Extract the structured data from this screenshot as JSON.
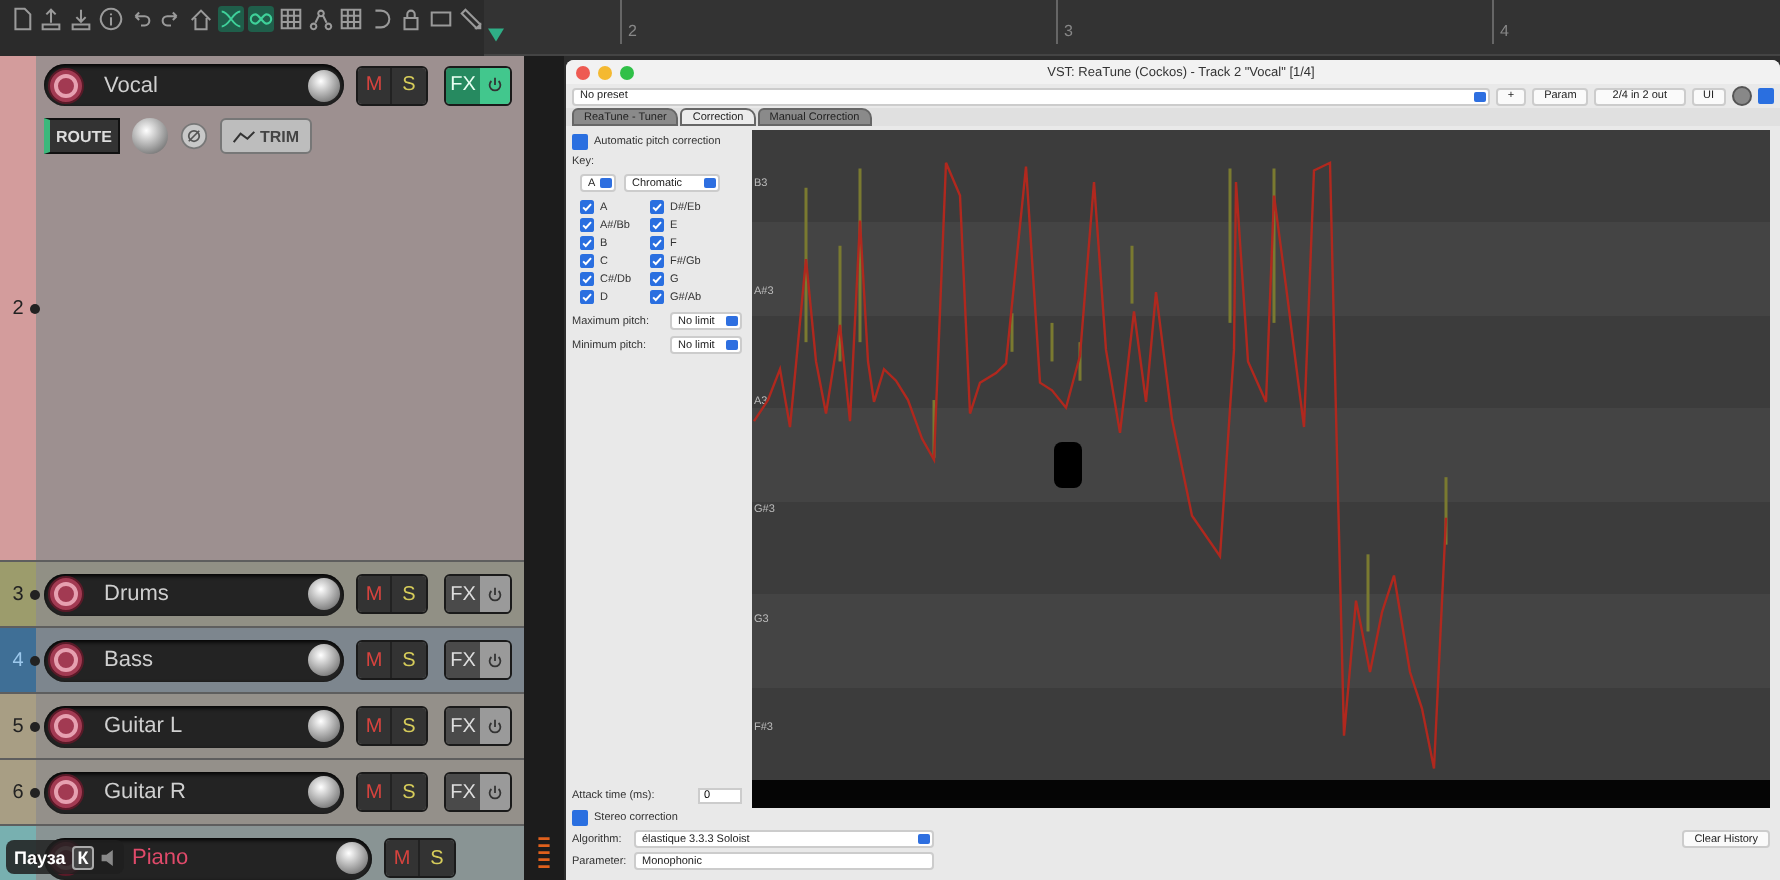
{
  "toolbar": [
    {
      "kind": "document",
      "on": false
    },
    {
      "kind": "upload",
      "on": false
    },
    {
      "kind": "download",
      "on": false
    },
    {
      "kind": "info",
      "on": false
    },
    {
      "kind": "undo",
      "on": false
    },
    {
      "kind": "redo",
      "on": false
    },
    {
      "kind": "house",
      "on": false
    },
    {
      "kind": "crossfade",
      "on": true
    },
    {
      "kind": "loop",
      "on": true
    },
    {
      "kind": "grid",
      "on": false
    },
    {
      "kind": "nodes",
      "on": false
    },
    {
      "kind": "grid",
      "on": false
    },
    {
      "kind": "curve",
      "on": false
    },
    {
      "kind": "lock",
      "on": false
    },
    {
      "kind": "rect",
      "on": false
    },
    {
      "kind": "pencil",
      "on": false
    }
  ],
  "ruler": {
    "marks": [
      "2",
      "3",
      "4"
    ]
  },
  "tracks": [
    {
      "kind": "expanded",
      "number": "2",
      "name": "Vocal",
      "color": "#d39c9c",
      "armed": false,
      "mute": "M",
      "solo": "S",
      "fx": "FX",
      "fx_on": true,
      "route": "ROUTE",
      "trim": "TRIM"
    },
    {
      "kind": "compact",
      "number": "3",
      "name": "Drums",
      "color": "#9c9c6c",
      "armed": false,
      "mute": "M",
      "solo": "S",
      "fx": "FX",
      "fx_on": false
    },
    {
      "kind": "compact",
      "number": "4",
      "name": "Bass",
      "color": "#3f6f96",
      "armed": false,
      "mute": "M",
      "solo": "S",
      "fx": "FX",
      "fx_on": false
    },
    {
      "kind": "compact",
      "number": "5",
      "name": "Guitar L",
      "color": "#a89e84",
      "armed": false,
      "mute": "M",
      "solo": "S",
      "fx": "FX",
      "fx_on": false
    },
    {
      "kind": "compact",
      "number": "6",
      "name": "Guitar R",
      "color": "#a89e84",
      "armed": false,
      "mute": "M",
      "solo": "S",
      "fx": "FX",
      "fx_on": false
    },
    {
      "kind": "compact",
      "name": "Piano",
      "color": "#78b0b0",
      "armed": true,
      "mute": "M",
      "solo": "S"
    }
  ],
  "overlay": {
    "label": "Пауза",
    "key": "К"
  },
  "plugin": {
    "title": "VST: ReaTune (Cockos) - Track 2 \"Vocal\" [1/4]",
    "preset": "No preset",
    "plus": "+",
    "param": "Param",
    "io": "2/4 in 2 out",
    "ui": "UI",
    "enabled": true,
    "tabs": [
      {
        "label": "ReaTune - Tuner",
        "selected": false
      },
      {
        "label": "Correction",
        "selected": true
      },
      {
        "label": "Manual Correction",
        "selected": false
      }
    ],
    "auto": {
      "label": "Automatic pitch correction",
      "checked": true
    },
    "key_label": "Key:",
    "key": "A",
    "scale": "Chromatic",
    "notes": [
      {
        "label": "A",
        "checked": true
      },
      {
        "label": "A#/Bb",
        "checked": true
      },
      {
        "label": "B",
        "checked": true
      },
      {
        "label": "C",
        "checked": true
      },
      {
        "label": "C#/Db",
        "checked": true
      },
      {
        "label": "D",
        "checked": true
      },
      {
        "label": "D#/Eb",
        "checked": true
      },
      {
        "label": "E",
        "checked": true
      },
      {
        "label": "F",
        "checked": true
      },
      {
        "label": "F#/Gb",
        "checked": true
      },
      {
        "label": "G",
        "checked": true
      },
      {
        "label": "G#/Ab",
        "checked": true
      }
    ],
    "max_pitch": {
      "label": "Maximum pitch:",
      "value": "No limit"
    },
    "min_pitch": {
      "label": "Minimum pitch:",
      "value": "No limit"
    },
    "pitch_labels": [
      "B3",
      "A#3",
      "A3",
      "G#3",
      "G3",
      "F#3"
    ],
    "attack": {
      "label": "Attack time (ms):",
      "value": "0"
    },
    "stereo": {
      "label": "Stereo correction",
      "checked": true
    },
    "algorithm": {
      "label": "Algorithm:",
      "value": "élastique 3.3.3 Soloist"
    },
    "parameter": {
      "label": "Parameter:",
      "value": "Monophonic"
    },
    "clear": "Clear History"
  }
}
